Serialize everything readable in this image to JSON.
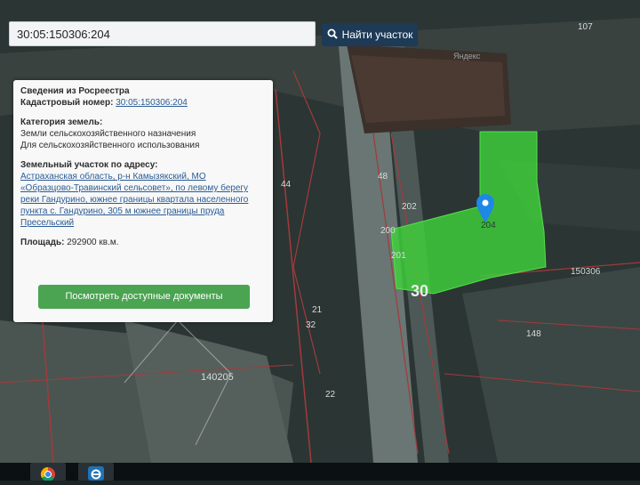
{
  "search": {
    "value": "30:05:150306:204",
    "button_label": "Найти участок"
  },
  "info": {
    "title": "Сведения из Росреестра",
    "cadastral_label": "Кадастровый номер:",
    "cadastral_value": "30:05:150306:204",
    "category_label": "Категория земель:",
    "category_line1": "Земли сельскохозяйственного назначения",
    "category_line2": "Для сельскохозяйственного использования",
    "address_label": "Земельный участок по адресу:",
    "address_lines": [
      "Астраханская область, р-н Камызякский, МО",
      "«Образцово-Травинский сельсовет», по левому берегу",
      "реки Гандурино, южнее границы квартала населенного",
      "пункта с. Гандурино, 305 м южнее границы пруда",
      "Пресельский"
    ],
    "area_label": "Площадь:",
    "area_value": "292900 кв.м.",
    "docs_button": "Посмотреть доступные документы"
  },
  "map_labels": {
    "l_44": "44",
    "l_48": "48",
    "l_202": "202",
    "l_200": "200",
    "l_201": "201",
    "l_204": "204",
    "l_30": "30",
    "l_150306": "150306",
    "l_148": "148",
    "l_140205": "140205",
    "l_21": "21",
    "l_32": "32",
    "l_22": "22",
    "l_107": "107",
    "l_yandex": "Яндекс"
  },
  "colors": {
    "parcel_fill": "#3fd23a",
    "search_btn": "#1d3a56",
    "docs_btn": "#4aa451",
    "marker": "#1e88e5"
  },
  "icons": {
    "search": "search-icon",
    "marker": "map-pin-icon",
    "chrome": "chrome-icon",
    "ie": "ie-icon"
  }
}
